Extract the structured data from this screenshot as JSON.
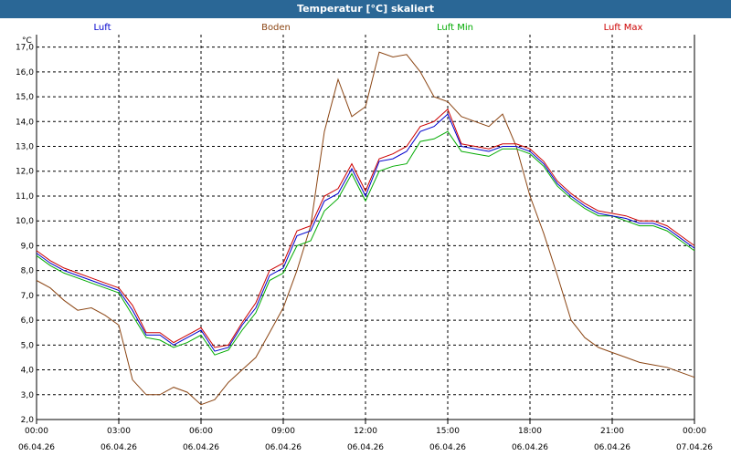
{
  "window": {
    "title": "Temperatur [°C] skaliert"
  },
  "chart_data": {
    "type": "line",
    "title": "Temperatur [°C] skaliert",
    "unit": "°C",
    "ylim": [
      2.0,
      17.5
    ],
    "yticks": [
      "2,0",
      "3,0",
      "4,0",
      "5,0",
      "6,0",
      "7,0",
      "8,0",
      "9,0",
      "10,0",
      "11,0",
      "12,0",
      "13,0",
      "14,0",
      "15,0",
      "16,0",
      "17,0"
    ],
    "xticks": [
      {
        "time": "00:00",
        "date": "06.04.26"
      },
      {
        "time": "03:00",
        "date": "06.04.26"
      },
      {
        "time": "06:00",
        "date": "06.04.26"
      },
      {
        "time": "09:00",
        "date": "06.04.26"
      },
      {
        "time": "12:00",
        "date": "06.04.26"
      },
      {
        "time": "15:00",
        "date": "06.04.26"
      },
      {
        "time": "18:00",
        "date": "06.04.26"
      },
      {
        "time": "21:00",
        "date": "06.04.26"
      },
      {
        "time": "00:00",
        "date": "07.04.26"
      }
    ],
    "x_hours": [
      0,
      0.5,
      1,
      1.5,
      2,
      2.5,
      3,
      3.5,
      4,
      4.5,
      5,
      5.5,
      6,
      6.5,
      7,
      7.5,
      8,
      8.5,
      9,
      9.5,
      10,
      10.5,
      11,
      11.5,
      12,
      12.5,
      13,
      13.5,
      14,
      14.5,
      15,
      15.5,
      16,
      16.5,
      17,
      17.5,
      18,
      18.5,
      19,
      19.5,
      20,
      20.5,
      21,
      21.5,
      22,
      22.5,
      23,
      23.5,
      24
    ],
    "grid": true,
    "legend_position": "top",
    "series": [
      {
        "name": "Luft",
        "color": "#0000cc",
        "values": [
          8.7,
          8.3,
          8.0,
          7.8,
          7.6,
          7.4,
          7.2,
          6.4,
          5.4,
          5.4,
          5.0,
          5.3,
          5.6,
          4.75,
          4.9,
          5.8,
          6.5,
          7.8,
          8.1,
          9.4,
          9.6,
          10.8,
          11.1,
          12.1,
          11.0,
          12.4,
          12.5,
          12.8,
          13.6,
          13.8,
          14.3,
          13.0,
          12.9,
          12.8,
          13.0,
          13.0,
          12.8,
          12.3,
          11.5,
          11.0,
          10.6,
          10.3,
          10.2,
          10.1,
          9.9,
          9.9,
          9.7,
          9.3,
          8.9
        ]
      },
      {
        "name": "Boden",
        "color": "#8b4513",
        "values": [
          7.6,
          7.3,
          6.8,
          6.4,
          6.5,
          6.2,
          5.8,
          3.6,
          3.0,
          3.0,
          3.3,
          3.1,
          2.6,
          2.8,
          3.5,
          4.0,
          4.5,
          5.5,
          6.5,
          8.0,
          9.8,
          13.6,
          15.7,
          14.2,
          14.6,
          16.8,
          16.6,
          16.7,
          16.0,
          15.0,
          14.8,
          14.2,
          14.0,
          13.8,
          14.3,
          13.0,
          11.0,
          9.5,
          7.8,
          6.0,
          5.3,
          4.9,
          4.7,
          4.5,
          4.3,
          4.2,
          4.1,
          3.9,
          3.7
        ]
      },
      {
        "name": "Luft Min",
        "color": "#00aa00",
        "values": [
          8.6,
          8.2,
          7.9,
          7.7,
          7.5,
          7.3,
          7.1,
          6.2,
          5.3,
          5.2,
          4.9,
          5.1,
          5.4,
          4.6,
          4.8,
          5.6,
          6.3,
          7.6,
          7.9,
          9.0,
          9.2,
          10.4,
          10.9,
          11.9,
          10.8,
          12.0,
          12.2,
          12.3,
          13.2,
          13.3,
          13.6,
          12.8,
          12.7,
          12.6,
          12.9,
          12.9,
          12.7,
          12.2,
          11.4,
          10.9,
          10.5,
          10.2,
          10.2,
          10.0,
          9.8,
          9.8,
          9.6,
          9.2,
          8.8
        ]
      },
      {
        "name": "Luft Max",
        "color": "#cc0000",
        "values": [
          8.8,
          8.4,
          8.1,
          7.9,
          7.7,
          7.5,
          7.3,
          6.6,
          5.5,
          5.5,
          5.1,
          5.4,
          5.7,
          4.9,
          5.0,
          5.9,
          6.7,
          8.0,
          8.3,
          9.6,
          9.8,
          11.0,
          11.3,
          12.3,
          11.2,
          12.5,
          12.7,
          13.0,
          13.8,
          14.0,
          14.5,
          13.1,
          13.0,
          12.9,
          13.1,
          13.1,
          12.9,
          12.4,
          11.6,
          11.1,
          10.7,
          10.4,
          10.3,
          10.2,
          10.0,
          10.0,
          9.8,
          9.4,
          9.0
        ]
      }
    ]
  }
}
